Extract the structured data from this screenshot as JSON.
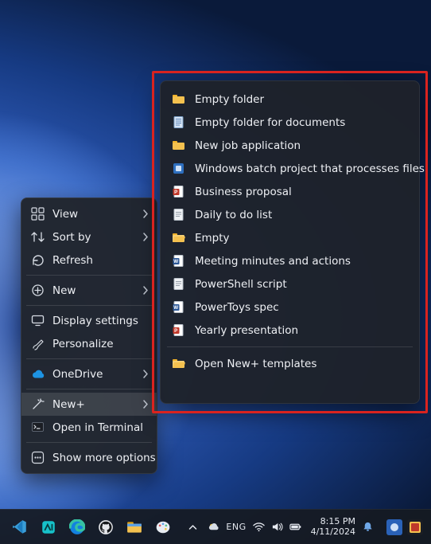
{
  "context_menu": {
    "items": [
      {
        "label": "View",
        "icon": "grid-icon",
        "submenu": true
      },
      {
        "label": "Sort by",
        "icon": "sort-icon",
        "submenu": true
      },
      {
        "label": "Refresh",
        "icon": "refresh-icon",
        "submenu": false
      }
    ],
    "items2": [
      {
        "label": "New",
        "icon": "plus-circle-icon",
        "submenu": true
      }
    ],
    "items3": [
      {
        "label": "Display settings",
        "icon": "display-icon",
        "submenu": false
      },
      {
        "label": "Personalize",
        "icon": "brush-icon",
        "submenu": false
      }
    ],
    "items4": [
      {
        "label": "OneDrive",
        "icon": "cloud-icon",
        "submenu": true
      }
    ],
    "items5": [
      {
        "label": "New+",
        "icon": "wand-icon",
        "submenu": true,
        "highlighted": true
      },
      {
        "label": "Open in Terminal",
        "icon": "terminal-icon",
        "submenu": false
      }
    ],
    "items6": [
      {
        "label": "Show more options",
        "icon": "more-icon",
        "submenu": false
      }
    ]
  },
  "newplus_menu": {
    "items": [
      {
        "label": "Empty folder",
        "icon": "folder"
      },
      {
        "label": "Empty folder for documents",
        "icon": "doc-lines"
      },
      {
        "label": "New job application",
        "icon": "folder"
      },
      {
        "label": "Windows batch project that processes files",
        "icon": "app"
      },
      {
        "label": "Business proposal",
        "icon": "pptx"
      },
      {
        "label": "Daily to do list",
        "icon": "doc"
      },
      {
        "label": "Empty",
        "icon": "folder-open"
      },
      {
        "label": "Meeting minutes and actions",
        "icon": "docx"
      },
      {
        "label": "PowerShell script",
        "icon": "doc"
      },
      {
        "label": "PowerToys spec",
        "icon": "docx"
      },
      {
        "label": "Yearly presentation",
        "icon": "pptx"
      }
    ],
    "footer": {
      "label": "Open New+ templates",
      "icon": "folder-open"
    }
  },
  "taskbar": {
    "apps": [
      {
        "name": "vscode",
        "color1": "#3a9dd8",
        "color2": "#1b7cc0"
      },
      {
        "name": "copilot-preview",
        "color1": "#17c1c9",
        "color2": "#0a8c92"
      },
      {
        "name": "edge",
        "color1": "#36c2a3",
        "color2": "#1381e0"
      },
      {
        "name": "github",
        "color1": "#e5e7eb",
        "color2": "#cfd3d9"
      },
      {
        "name": "explorer",
        "color1": "#f4c14f",
        "color2": "#e8a40a"
      },
      {
        "name": "paint",
        "color1": "#8fa4d8",
        "color2": "#8fa4d8"
      }
    ],
    "tray": {
      "language": "ENG",
      "time": "8:15 PM",
      "date": "4/11/2024"
    }
  },
  "colors": {
    "highlight_border": "#d9231f",
    "menu_bg": "rgba(32,36,44,0.96)",
    "onedrive": "#1d93e3"
  }
}
